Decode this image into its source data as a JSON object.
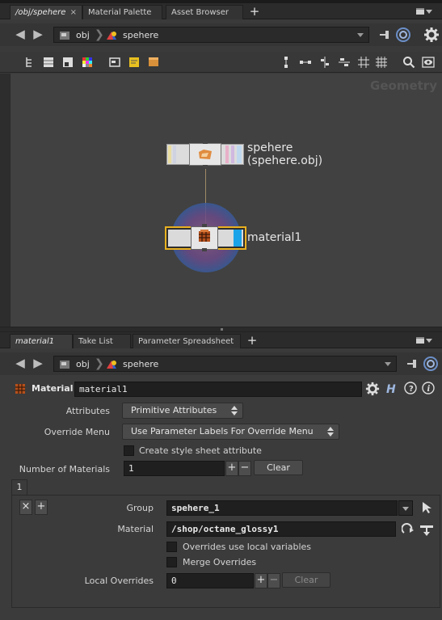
{
  "top_tabs": [
    {
      "label": "/obj/spehere",
      "active": true
    },
    {
      "label": "Material Palette",
      "active": false
    },
    {
      "label": "Asset Browser",
      "active": false
    }
  ],
  "path": {
    "root": "obj",
    "node": "spehere"
  },
  "network": {
    "context_label": "Geometry",
    "nodes": [
      {
        "name": "spehere",
        "subtitle": "(spehere.obj)"
      },
      {
        "name": "material1"
      }
    ]
  },
  "bottom_tabs": [
    {
      "label": "material1",
      "active": true
    },
    {
      "label": "Take List",
      "active": false
    },
    {
      "label": "Parameter Spreadsheet",
      "active": false
    }
  ],
  "bottom_path": {
    "root": "obj",
    "node": "spehere"
  },
  "params": {
    "node_type": "Material",
    "node_name": "material1",
    "attributes_label": "Attributes",
    "attributes_value": "Primitive Attributes",
    "override_menu_label": "Override Menu",
    "override_menu_value": "Use Parameter Labels For Override Menu",
    "create_style_sheet": "Create style sheet attribute",
    "num_materials_label": "Number of Materials",
    "num_materials_value": "1",
    "clear_label": "Clear",
    "multiparm_tab": "1",
    "group_label": "Group",
    "group_value": "spehere_1",
    "material_label": "Material",
    "material_value": "/shop/octane_glossy1",
    "overrides_local_vars": "Overrides use local variables",
    "merge_overrides": "Merge Overrides",
    "local_overrides_label": "Local Overrides",
    "local_overrides_value": "0",
    "plus": "+",
    "minus": "−",
    "remove": "×"
  },
  "colors": {
    "accent_yellow": "#e8b020",
    "halo_blue": "#3a5a9a",
    "halo_purple": "#6a4a88",
    "flag_blue": "#1aa3e8"
  }
}
